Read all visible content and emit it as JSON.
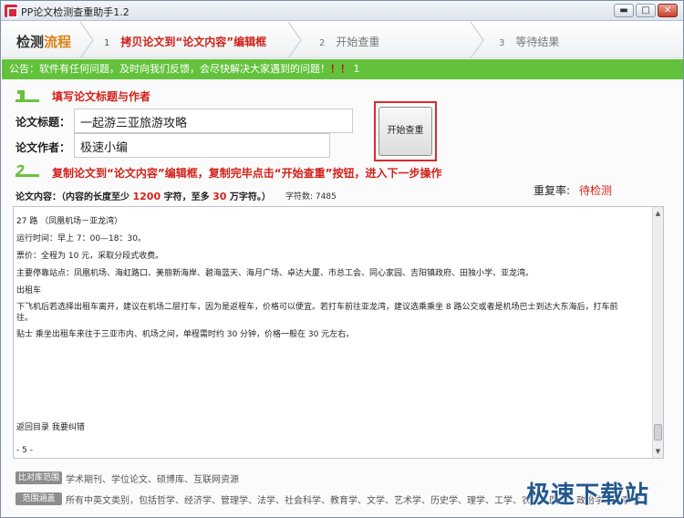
{
  "window": {
    "title": "PP论文检测查重助手1.2",
    "controls": {
      "minimize": "▬",
      "maximize": "□",
      "close": "✕"
    }
  },
  "steps": {
    "heading_a": "检测",
    "heading_b": "流程",
    "items": [
      {
        "num": "1",
        "label": "拷贝论文到“论文内容”编辑框"
      },
      {
        "num": "2",
        "label": "开始查重"
      },
      {
        "num": "3",
        "label": "等待结果"
      }
    ]
  },
  "notice": {
    "text": "公告：软件有任何问题，及时向我们反馈，会尽快解决大家遇到的问题！",
    "excl": "！！",
    "suffix": "1"
  },
  "section1": {
    "title": "填写论文标题与作者"
  },
  "form": {
    "title_label": "论文标题：",
    "title_value": "一起游三亚旅游攻略",
    "author_label": "论文作者：",
    "author_value": "极速小编"
  },
  "start_button": "开始查重",
  "section2": {
    "title": "复制论文到“论文内容”编辑框，复制完毕点击“开始查重”按钮，进入下一步操作"
  },
  "content_info": {
    "a": "论文内容：（内容的长度至少",
    "min": "1200",
    "b": "字符，至多",
    "max": "30",
    "c": "万字符。）",
    "count": "字符数: 7485"
  },
  "rate": {
    "label": "重复率:",
    "value": "待检测"
  },
  "editor_lines": [
    "27 路 （凤凰机场－亚龙湾）",
    "运行时间：早上 7：00—18：30。",
    "票价：全程为 10 元，采取分段式收费。",
    "主要停靠站点：凤凰机场、海虹路口、美丽新海岸、碧海蓝天、海月广场、卓达大厦、市总工会、同心家园、吉阳镇政府、田独小学、亚龙湾。",
    "出租车",
    "下飞机后若选择出租车离开，建议在机场二层打车，因为是返程车，价格可以便宜。若打车前往亚龙湾，建议选乘乘坐 8 路公交或者是机场巴士到达大东海后，打车前",
    "往。",
    "贴士 乘坐出租车来往于三亚市内、机场之间，单程需时约 30 分钟，价格一般在 30 元左右。",
    "返回目录        我要纠错",
    "- 5 -"
  ],
  "footer": {
    "tag1": "比对库范围",
    "text1": "学术期刊、学位论文、硕博库、互联网资源",
    "tag2": "范围涵盖",
    "text2": "所有中英文类别，包括哲学、经济学、管理学、法学、社会科学、教育学、文学、艺术学、历史学、理学、工学、农学、医学、政治学、军事学"
  },
  "watermark": "极速下载站",
  "colors": {
    "notice_bg": "#62c23b",
    "accent_red": "#d2211a",
    "accent_orange": "#e07f12"
  }
}
